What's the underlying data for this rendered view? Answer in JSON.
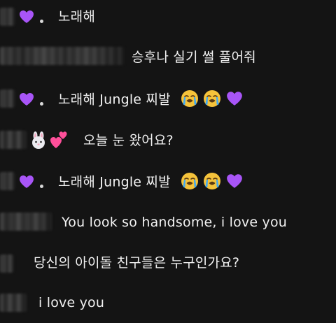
{
  "messages": [
    {
      "text": "노래해",
      "prefix": "purple-heart"
    },
    {
      "text": "승후나 실기 썰 풀어줘"
    },
    {
      "text": "노래해 Jungle 찌발",
      "prefix": "purple-heart",
      "suffix_emojis": [
        "loudly-crying-face",
        "loudly-crying-face",
        "purple-heart"
      ]
    },
    {
      "text": "오늘 눈 왔어요?",
      "prefix_emojis": [
        "rabbit-face",
        "two-hearts"
      ]
    },
    {
      "text": "노래해 Jungle 찌발",
      "prefix": "purple-heart",
      "suffix_emojis": [
        "loudly-crying-face",
        "loudly-crying-face",
        "purple-heart"
      ]
    },
    {
      "text": "You look so handsome, i love you"
    },
    {
      "text": "당신의 아이돌 친구들은 누구인가요?"
    },
    {
      "text": "i love you"
    }
  ],
  "colors": {
    "background": "#141414",
    "text": "#f2f2f2",
    "purple_heart": "#a855f7",
    "tear_face": "#f5c33b",
    "tear": "#3fa9f5"
  }
}
